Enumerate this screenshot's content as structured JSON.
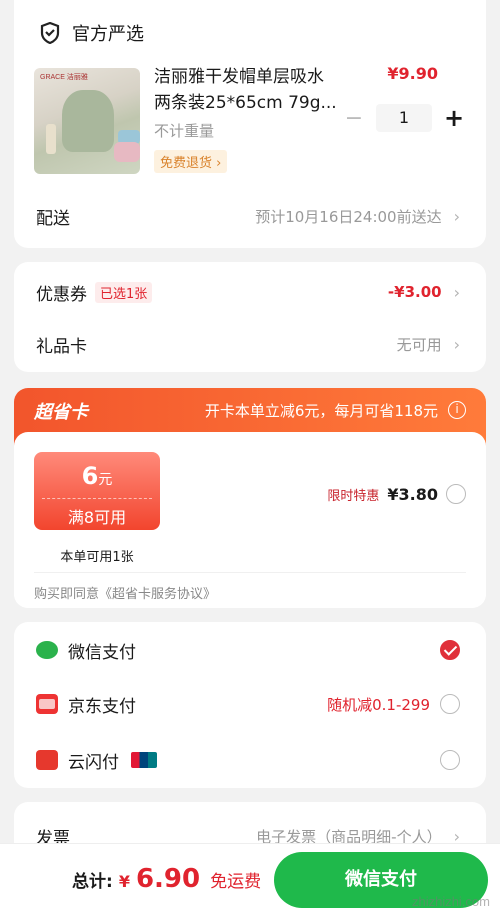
{
  "shop": {
    "name": "官方严选",
    "product": {
      "title_line1": "洁丽雅干发帽单层吸水",
      "title_line2": "两条装25*65cm 79g...",
      "price": "¥9.90",
      "weight": "不计重量",
      "badge": "免费退货 ›",
      "quantity": "1",
      "thumb_brand": "GRACE 洁丽雅"
    },
    "delivery": {
      "label": "配送",
      "value": "预计10月16日24:00前送达"
    }
  },
  "coupon": {
    "label": "优惠券",
    "tag": "已选1张",
    "value": "-¥3.00",
    "gift_label": "礼品卡",
    "gift_value": "无可用"
  },
  "super_card": {
    "name": "超省卡",
    "desc": "开卡本单立减6元，每月可省118元",
    "ticket_amount": "6",
    "ticket_unit": "元",
    "ticket_condition": "满8可用",
    "ticket_note": "本单可用1张",
    "limited": "限时特惠",
    "price": "¥3.80",
    "agreement": "购买即同意《超省卡服务协议》"
  },
  "payment": {
    "methods": [
      {
        "label": "微信支付",
        "note": "",
        "selected": true
      },
      {
        "label": "京东支付",
        "note": "随机减0.1-299",
        "selected": false
      },
      {
        "label": "云闪付",
        "note": "",
        "selected": false
      }
    ]
  },
  "invoice": {
    "label": "发票",
    "value": "电子发票（商品明细-个人）"
  },
  "footer": {
    "total_label": "总计:",
    "currency": "¥",
    "total": "6.90",
    "shipping": "免运费",
    "pay_button": "微信支付",
    "watermark": "zhizhizhi.com"
  },
  "colors": {
    "accent_red": "#e0232e",
    "wechat_green": "#1fb94b",
    "super_orange": "#f2552c"
  }
}
